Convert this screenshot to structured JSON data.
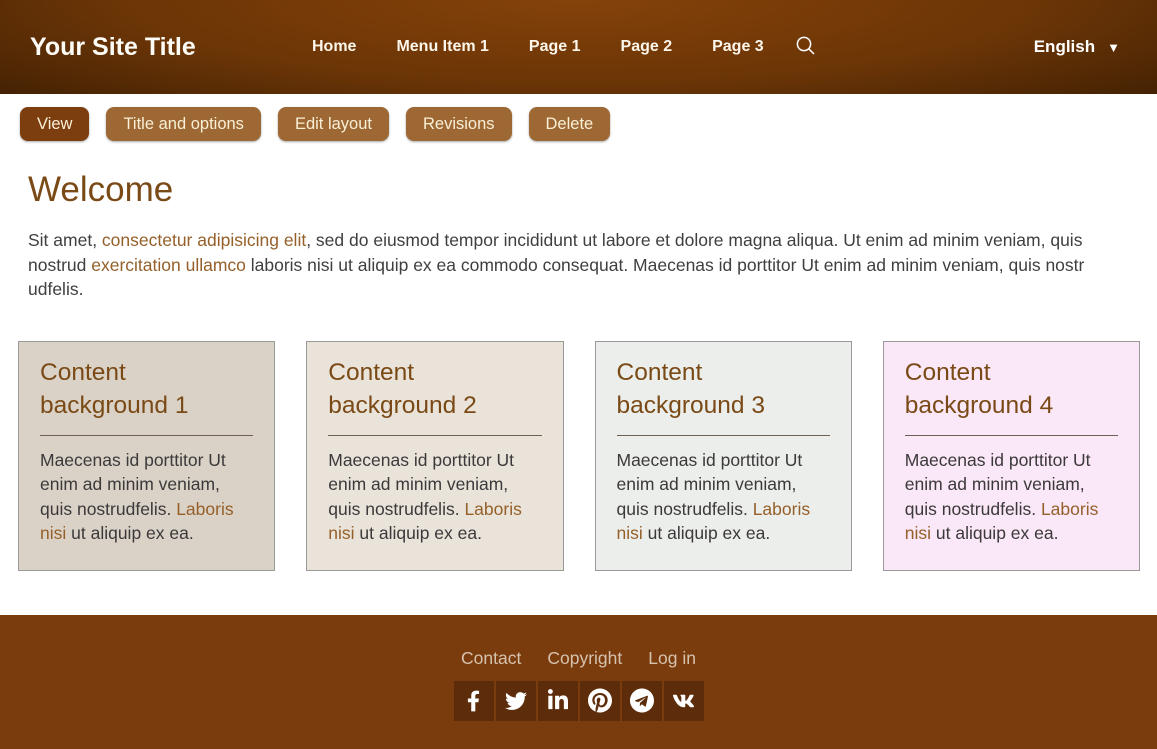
{
  "site": {
    "title": "Your Site Title"
  },
  "header": {
    "nav": [
      {
        "label": "Home"
      },
      {
        "label": "Menu Item 1"
      },
      {
        "label": "Page 1"
      },
      {
        "label": "Page 2"
      },
      {
        "label": "Page 3"
      }
    ],
    "language": {
      "label": "English",
      "caret": "▼"
    }
  },
  "admin_tabs": [
    {
      "label": "View",
      "active": true
    },
    {
      "label": "Title and options",
      "active": false
    },
    {
      "label": "Edit layout",
      "active": false
    },
    {
      "label": "Revisions",
      "active": false
    },
    {
      "label": "Delete",
      "active": false
    }
  ],
  "main": {
    "heading": "Welcome",
    "intro": {
      "part1": "Sit amet, ",
      "link1": "consectetur adipisicing elit",
      "part2": ", sed do eiusmod tempor incididunt ut labore et dolore magna aliqua. Ut enim ad minim veniam, quis nostrud ",
      "link2": "exercitation ullamco",
      "part3": " laboris nisi ut aliquip ex ea commodo consequat. Maecenas id porttitor Ut enim ad minim veniam, quis nostr udfelis."
    },
    "cards": [
      {
        "title": "Content background 1",
        "text1": "Maecenas id porttitor Ut enim ad minim veniam, quis nostrudfelis. ",
        "link": "Laboris nisi",
        "text2": " ut aliquip ex ea.",
        "bg": "#dbd2c7"
      },
      {
        "title": "Content background 2",
        "text1": "Maecenas id porttitor Ut enim ad minim veniam, quis nostrudfelis. ",
        "link": "Laboris nisi",
        "text2": " ut aliquip ex ea.",
        "bg": "#eae3da"
      },
      {
        "title": "Content background 3",
        "text1": "Maecenas id porttitor Ut enim ad minim veniam, quis nostrudfelis. ",
        "link": "Laboris nisi",
        "text2": " ut aliquip ex ea.",
        "bg": "#eceeeb"
      },
      {
        "title": "Content background 4",
        "text1": "Maecenas id porttitor Ut enim ad minim veniam, quis nostrudfelis. ",
        "link": "Laboris nisi",
        "text2": " ut aliquip ex ea.",
        "bg": "#fae7f7"
      }
    ]
  },
  "footer": {
    "links": [
      {
        "label": "Contact"
      },
      {
        "label": "Copyright"
      },
      {
        "label": "Log in"
      }
    ],
    "social": [
      {
        "name": "facebook"
      },
      {
        "name": "twitter"
      },
      {
        "name": "linkedin"
      },
      {
        "name": "pinterest"
      },
      {
        "name": "telegram"
      },
      {
        "name": "vk"
      }
    ]
  },
  "colors": {
    "accent_brown": "#7a4a16",
    "link_brown": "#95602a",
    "tab_bg": "#9d6833",
    "tab_active_bg": "#7c3e0f",
    "footer_bg": "#7a3c0c",
    "social_tile_bg": "#5d2d0b"
  }
}
